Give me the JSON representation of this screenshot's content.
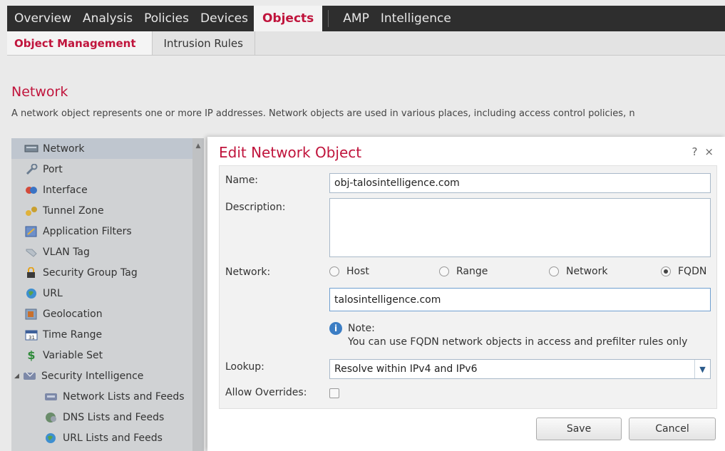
{
  "topnav": {
    "items": [
      "Overview",
      "Analysis",
      "Policies",
      "Devices",
      "Objects",
      "AMP",
      "Intelligence"
    ],
    "active": "Objects"
  },
  "subnav": {
    "tabs": [
      "Object Management",
      "Intrusion Rules"
    ]
  },
  "page": {
    "title": "Network",
    "description": "A network object represents one or more IP addresses. Network objects are used in various places, including access control policies, n"
  },
  "sidebar": {
    "items": [
      {
        "label": "Network",
        "icon": "network-icon"
      },
      {
        "label": "Port",
        "icon": "wrench-icon"
      },
      {
        "label": "Interface",
        "icon": "interface-icon"
      },
      {
        "label": "Tunnel Zone",
        "icon": "tunnel-icon"
      },
      {
        "label": "Application Filters",
        "icon": "filter-icon"
      },
      {
        "label": "VLAN Tag",
        "icon": "tag-icon"
      },
      {
        "label": "Security Group Tag",
        "icon": "lock-icon"
      },
      {
        "label": "URL",
        "icon": "globe-icon"
      },
      {
        "label": "Geolocation",
        "icon": "map-icon"
      },
      {
        "label": "Time Range",
        "icon": "calendar-icon"
      },
      {
        "label": "Variable Set",
        "icon": "dollar-icon"
      },
      {
        "label": "Security Intelligence",
        "icon": "shield-icon"
      },
      {
        "label": "Network Lists and Feeds",
        "icon": "list-icon"
      },
      {
        "label": "DNS Lists and Feeds",
        "icon": "dns-icon"
      },
      {
        "label": "URL Lists and Feeds",
        "icon": "url-list-icon"
      }
    ]
  },
  "dialog": {
    "title": "Edit Network Object",
    "help": "?",
    "close": "×",
    "name_label": "Name:",
    "name_value": "obj-talosintelligence.com",
    "description_label": "Description:",
    "description_value": "",
    "network_label": "Network:",
    "network_options": [
      "Host",
      "Range",
      "Network",
      "FQDN"
    ],
    "network_selected": "FQDN",
    "network_value": "talosintelligence.com",
    "note_title": "Note:",
    "note_text": "You can use FQDN network objects in access and prefilter rules only",
    "lookup_label": "Lookup:",
    "lookup_value": "Resolve within IPv4 and IPv6",
    "overrides_label": "Allow Overrides:",
    "overrides_checked": false,
    "save_label": "Save",
    "cancel_label": "Cancel"
  }
}
